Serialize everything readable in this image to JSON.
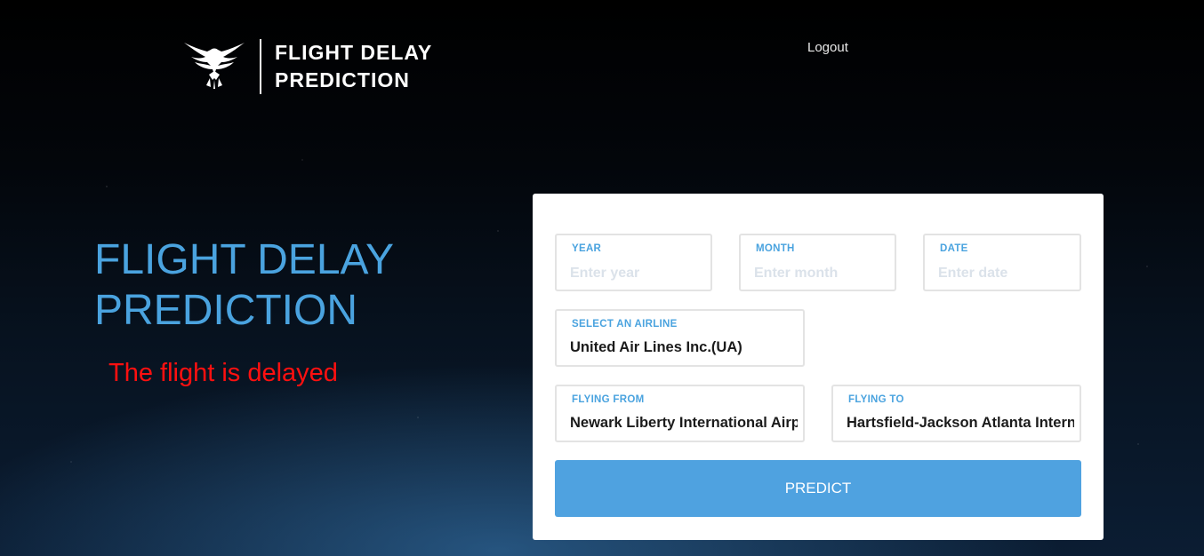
{
  "header": {
    "brand_line1": "FLIGHT DELAY",
    "brand_line2": "PREDICTION",
    "logout_label": "Logout"
  },
  "hero": {
    "title_line1": "FLIGHT DELAY",
    "title_line2": "PREDICTION",
    "result_text": "The flight is delayed"
  },
  "form": {
    "year": {
      "label": "YEAR",
      "placeholder": "Enter year",
      "value": ""
    },
    "month": {
      "label": "MONTH",
      "placeholder": "Enter month",
      "value": ""
    },
    "date": {
      "label": "DATE",
      "placeholder": "Enter date",
      "value": ""
    },
    "airline": {
      "label": "SELECT AN AIRLINE",
      "value": "United Air Lines Inc.(UA)"
    },
    "origin": {
      "label": "FLYING FROM",
      "value": "Newark Liberty International Airport (EWR)"
    },
    "destination": {
      "label": "FLYING TO",
      "value": "Hartsfield-Jackson Atlanta International Airport (ATL)"
    },
    "predict_label": "PREDICT"
  },
  "icons": {
    "logo": "eagle-logo-icon"
  },
  "colors": {
    "accent": "#4aa3df",
    "button": "#4fa2e0",
    "result": "#ff1010",
    "field_border": "#e3e3e3"
  }
}
